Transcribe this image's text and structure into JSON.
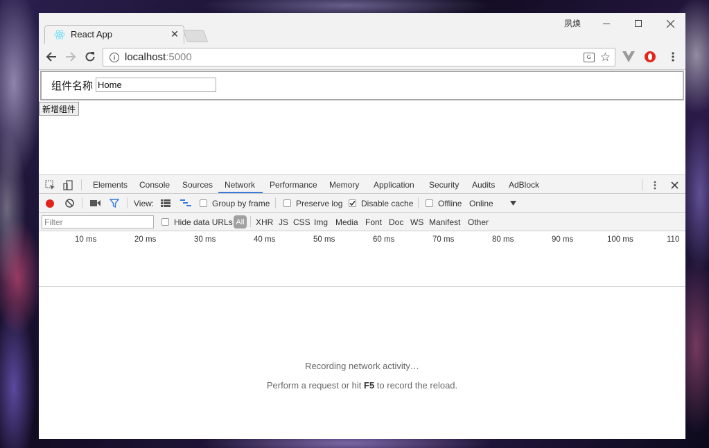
{
  "window": {
    "user_name": "夙焕",
    "minimize": "—",
    "maximize": "☐",
    "close": "✕"
  },
  "tab": {
    "title": "React App",
    "close": "✕"
  },
  "toolbar": {
    "url_host": "localhost",
    "url_port": ":5000"
  },
  "page": {
    "component_label": "组件名称",
    "component_value": "Home",
    "add_button": "新增组件"
  },
  "devtools": {
    "tabs": [
      "Elements",
      "Console",
      "Sources",
      "Network",
      "Performance",
      "Memory",
      "Application",
      "Security",
      "Audits",
      "AdBlock"
    ],
    "active_tab": "Network",
    "view_label": "View:",
    "group_by_frame": "Group by frame",
    "preserve_log": "Preserve log",
    "disable_cache": "Disable cache",
    "offline": "Offline",
    "throttle": "Online",
    "filter_placeholder": "Filter",
    "hide_data_urls": "Hide data URLs",
    "type_filters": [
      "All",
      "XHR",
      "JS",
      "CSS",
      "Img",
      "Media",
      "Font",
      "Doc",
      "WS",
      "Manifest",
      "Other"
    ],
    "timeline_ticks": [
      "10 ms",
      "20 ms",
      "30 ms",
      "40 ms",
      "50 ms",
      "60 ms",
      "70 ms",
      "80 ms",
      "90 ms",
      "100 ms",
      "110"
    ],
    "recording_msg": "Recording network activity…",
    "hint_prefix": "Perform a request or hit ",
    "hint_key": "F5",
    "hint_suffix": " to record the reload.",
    "disable_cache_checked": true,
    "preserve_log_checked": false,
    "group_by_frame_checked": false,
    "offline_checked": false,
    "hide_data_urls_checked": false
  },
  "colors": {
    "record": "#e0241c",
    "accent": "#3879d9"
  }
}
